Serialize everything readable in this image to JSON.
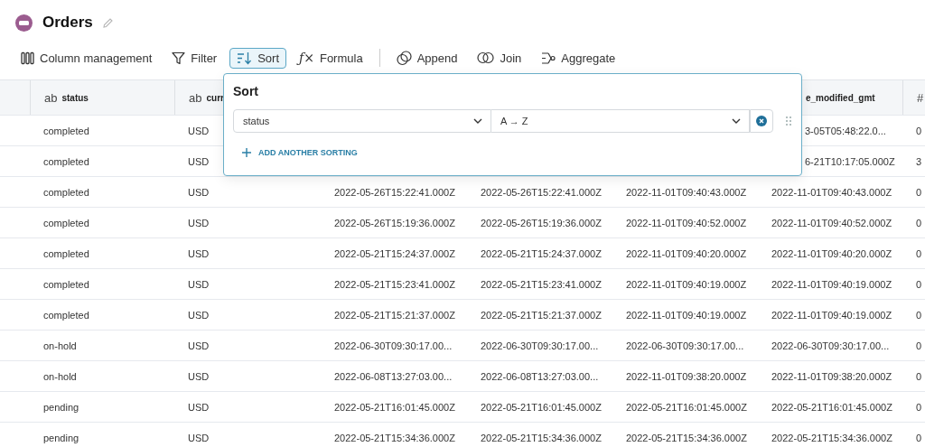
{
  "page": {
    "title": "Orders"
  },
  "toolbar": [
    {
      "kind": "columns",
      "label": "Column management",
      "selected": false
    },
    {
      "kind": "filter",
      "label": "Filter",
      "selected": false
    },
    {
      "kind": "sort",
      "label": "Sort",
      "selected": true
    },
    {
      "kind": "formula",
      "glyph": "ƒ×",
      "label": "Formula",
      "selected": false
    },
    {
      "kind": "divider"
    },
    {
      "kind": "append",
      "label": "Append",
      "selected": false
    },
    {
      "kind": "join",
      "label": "Join",
      "selected": false
    },
    {
      "kind": "aggregate",
      "label": "Aggregate",
      "selected": false
    }
  ],
  "sort_panel": {
    "title": "Sort",
    "rules": [
      {
        "field": "status",
        "order": "A → Z"
      }
    ],
    "add_label": "ADD ANOTHER SORTING"
  },
  "table": {
    "columns": [
      {
        "type": "ab",
        "name": "status"
      },
      {
        "type": "ab",
        "name": "curr"
      },
      null,
      null,
      null,
      {
        "name": "e_modified_gmt"
      },
      {
        "type": "#"
      }
    ],
    "rows": [
      [
        "completed",
        "USD",
        null,
        null,
        null,
        "3-05T05:48:22.0...",
        "0"
      ],
      [
        "completed",
        "USD",
        null,
        null,
        null,
        "6-21T10:17:05.000Z",
        "3"
      ],
      [
        "completed",
        "USD",
        "2022-05-26T15:22:41.000Z",
        "2022-05-26T15:22:41.000Z",
        "2022-11-01T09:40:43.000Z",
        "2022-11-01T09:40:43.000Z",
        "0"
      ],
      [
        "completed",
        "USD",
        "2022-05-26T15:19:36.000Z",
        "2022-05-26T15:19:36.000Z",
        "2022-11-01T09:40:52.000Z",
        "2022-11-01T09:40:52.000Z",
        "0"
      ],
      [
        "completed",
        "USD",
        "2022-05-21T15:24:37.000Z",
        "2022-05-21T15:24:37.000Z",
        "2022-11-01T09:40:20.000Z",
        "2022-11-01T09:40:20.000Z",
        "0"
      ],
      [
        "completed",
        "USD",
        "2022-05-21T15:23:41.000Z",
        "2022-05-21T15:23:41.000Z",
        "2022-11-01T09:40:19.000Z",
        "2022-11-01T09:40:19.000Z",
        "0"
      ],
      [
        "completed",
        "USD",
        "2022-05-21T15:21:37.000Z",
        "2022-05-21T15:21:37.000Z",
        "2022-11-01T09:40:19.000Z",
        "2022-11-01T09:40:19.000Z",
        "0"
      ],
      [
        "on-hold",
        "USD",
        "2022-06-30T09:30:17.00...",
        "2022-06-30T09:30:17.00...",
        "2022-06-30T09:30:17.00...",
        "2022-06-30T09:30:17.00...",
        "0"
      ],
      [
        "on-hold",
        "USD",
        "2022-06-08T13:27:03.00...",
        "2022-06-08T13:27:03.00...",
        "2022-11-01T09:38:20.000Z",
        "2022-11-01T09:38:20.000Z",
        "0"
      ],
      [
        "pending",
        "USD",
        "2022-05-21T16:01:45.000Z",
        "2022-05-21T16:01:45.000Z",
        "2022-05-21T16:01:45.000Z",
        "2022-05-21T16:01:45.000Z",
        "0"
      ],
      [
        "pending",
        "USD",
        "2022-05-21T15:34:36.000Z",
        "2022-05-21T15:34:36.000Z",
        "2022-05-21T15:34:36.000Z",
        "2022-05-21T15:34:36.000Z",
        "0"
      ]
    ]
  }
}
